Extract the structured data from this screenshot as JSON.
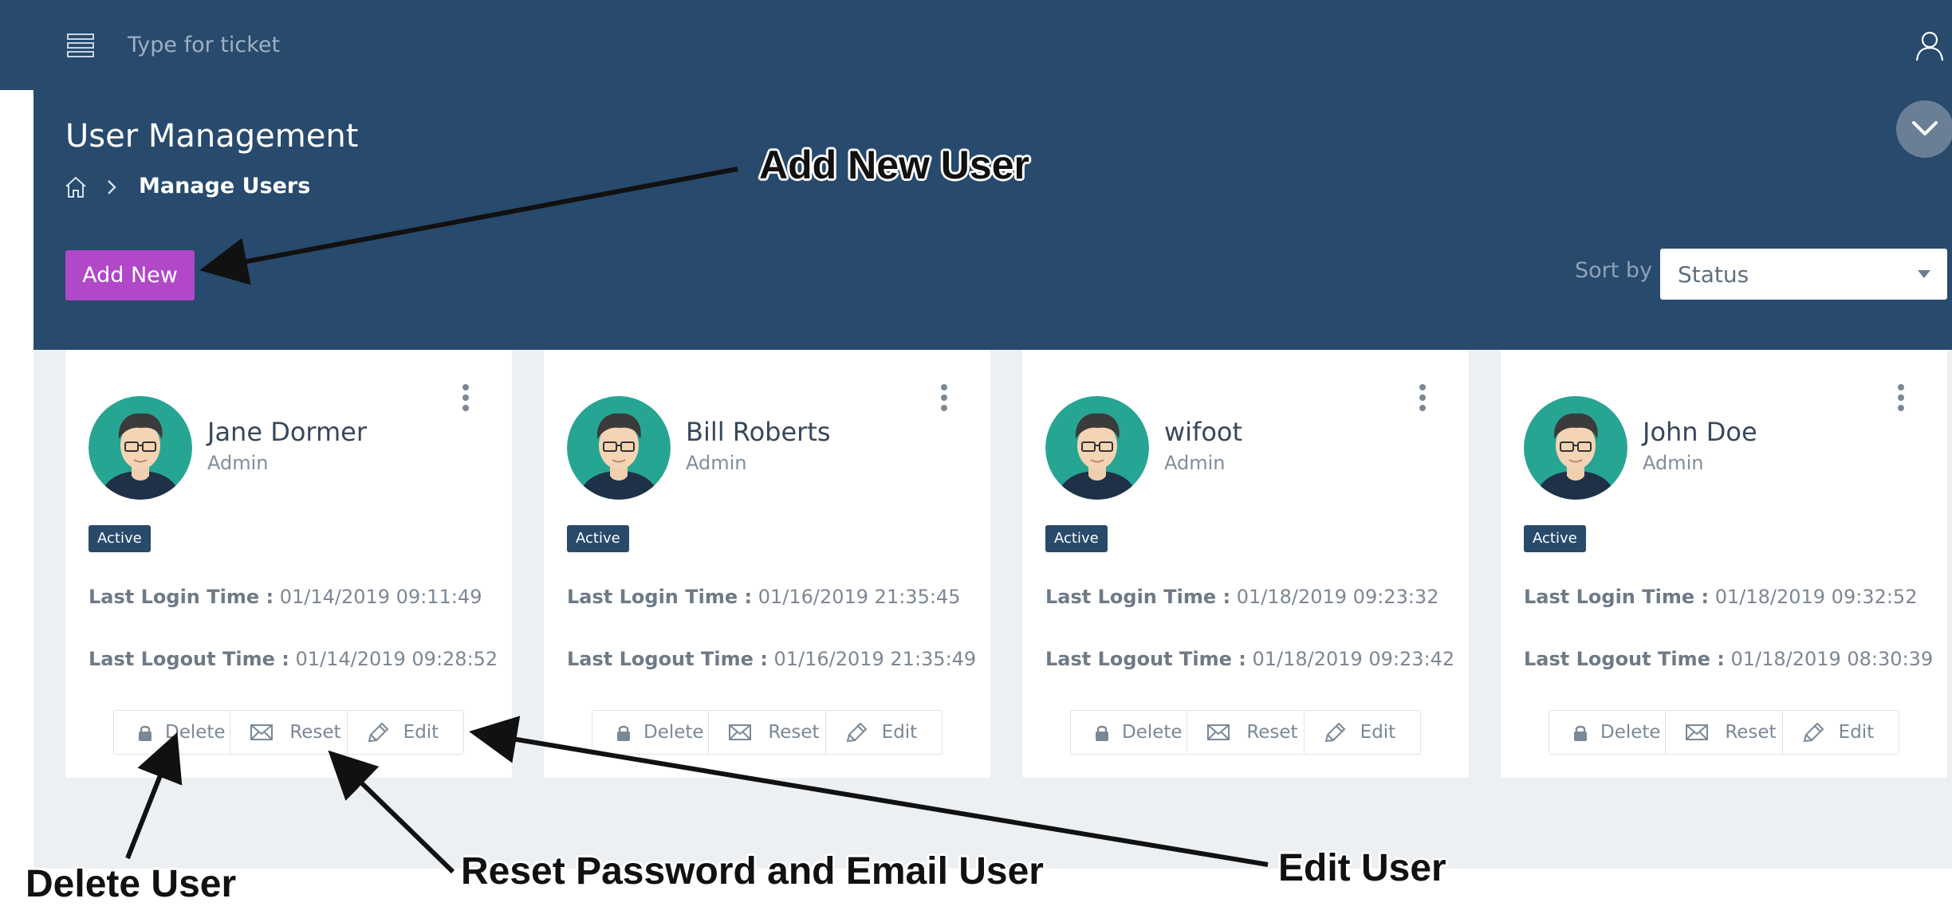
{
  "header": {
    "search_placeholder": "Type for ticket"
  },
  "page": {
    "title": "User Management",
    "breadcrumb_current": "Manage Users",
    "add_button_label": "Add New",
    "sort_label": "Sort by :",
    "sort_value": "Status"
  },
  "labels": {
    "last_login": "Last Login Time :",
    "last_logout": "Last Logout Time :"
  },
  "users": [
    {
      "name": "Jane Dormer",
      "role": "Admin",
      "status": "Active",
      "last_login": "01/14/2019 09:11:49",
      "last_logout": "01/14/2019 09:28:52",
      "actions": {
        "delete": "Delete",
        "reset": "Reset",
        "edit": "Edit"
      }
    },
    {
      "name": "Bill Roberts",
      "role": "Admin",
      "status": "Active",
      "last_login": "01/16/2019 21:35:45",
      "last_logout": "01/16/2019 21:35:49",
      "actions": {
        "delete": "Delete",
        "reset": "Reset",
        "edit": "Edit"
      }
    },
    {
      "name": "wifoot",
      "role": "Admin",
      "status": "Active",
      "last_login": "01/18/2019 09:23:32",
      "last_logout": "01/18/2019 09:23:42",
      "actions": {
        "delete": "Delete",
        "reset": "Reset",
        "edit": "Edit"
      }
    },
    {
      "name": "John Doe",
      "role": "Admin",
      "status": "Active",
      "last_login": "01/18/2019 09:32:52",
      "last_logout": "01/18/2019 08:30:39",
      "actions": {
        "delete": "Delete",
        "reset": "Reset",
        "edit": "Edit"
      }
    }
  ],
  "annotations": {
    "add_new_user": "Add New User",
    "delete_user": "Delete User",
    "reset_password": "Reset Password and Email User",
    "edit_user": "Edit User"
  },
  "icons": {
    "menu": "menu-icon",
    "user": "user-icon",
    "collapse": "chevron-down-icon",
    "home": "home-icon",
    "breadcrumb_separator": "chevron-right-icon",
    "card_menu": "kebab-icon",
    "delete": "lock-icon",
    "reset": "envelope-icon",
    "edit": "pencil-icon"
  },
  "colors": {
    "header_bg": "#274a6d",
    "content_bg": "#ecf0f3",
    "add_button": "#b148c8",
    "badge": "#284a6b",
    "avatar_bg": "#27a593"
  }
}
